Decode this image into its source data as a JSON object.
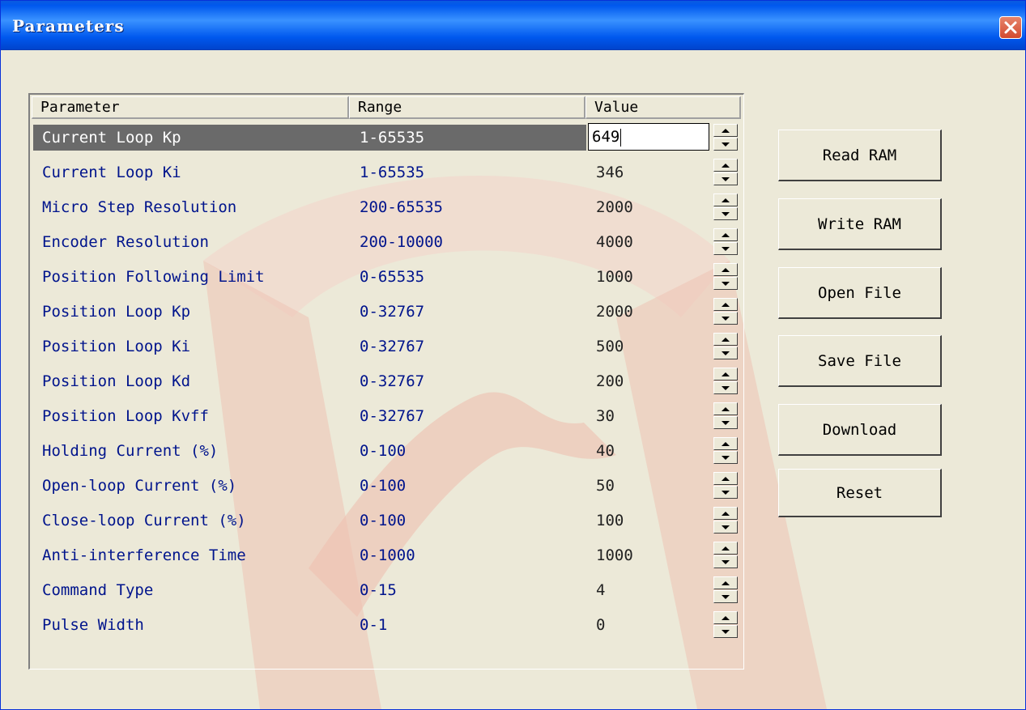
{
  "window": {
    "title": "Parameters"
  },
  "table": {
    "columns": [
      "Parameter",
      "Range",
      "Value"
    ],
    "rows": [
      {
        "parameter": "Current Loop Kp",
        "range": "1-65535",
        "value": "649",
        "selected": true
      },
      {
        "parameter": "Current Loop Ki",
        "range": "1-65535",
        "value": "346"
      },
      {
        "parameter": "Micro Step Resolution",
        "range": "200-65535",
        "value": "2000"
      },
      {
        "parameter": "Encoder Resolution",
        "range": "200-10000",
        "value": "4000"
      },
      {
        "parameter": "Position Following Limit",
        "range": "0-65535",
        "value": "1000"
      },
      {
        "parameter": "Position Loop Kp",
        "range": "0-32767",
        "value": "2000"
      },
      {
        "parameter": "Position Loop Ki",
        "range": "0-32767",
        "value": "500"
      },
      {
        "parameter": "Position Loop Kd",
        "range": "0-32767",
        "value": "200"
      },
      {
        "parameter": "Position Loop Kvff",
        "range": "0-32767",
        "value": "30"
      },
      {
        "parameter": "Holding Current (%)",
        "range": "0-100",
        "value": "40"
      },
      {
        "parameter": "Open-loop Current (%)",
        "range": "0-100",
        "value": "50"
      },
      {
        "parameter": "Close-loop Current (%)",
        "range": "0-100",
        "value": "100"
      },
      {
        "parameter": "Anti-interference Time",
        "range": "0-1000",
        "value": "1000"
      },
      {
        "parameter": "Command Type",
        "range": "0-15",
        "value": "4"
      },
      {
        "parameter": "Pulse Width",
        "range": "0-1",
        "value": "0"
      }
    ]
  },
  "buttons": {
    "read_ram": "Read RAM",
    "write_ram": "Write RAM",
    "open_file": "Open File",
    "save_file": "Save File",
    "download": "Download",
    "reset": "Reset"
  },
  "colors": {
    "titlebar": "#0058EE",
    "dialog_bg": "#ECE9D8",
    "text_blue": "#00148C",
    "selection": "#6A6A6A",
    "watermark": "#F2C9BF"
  }
}
